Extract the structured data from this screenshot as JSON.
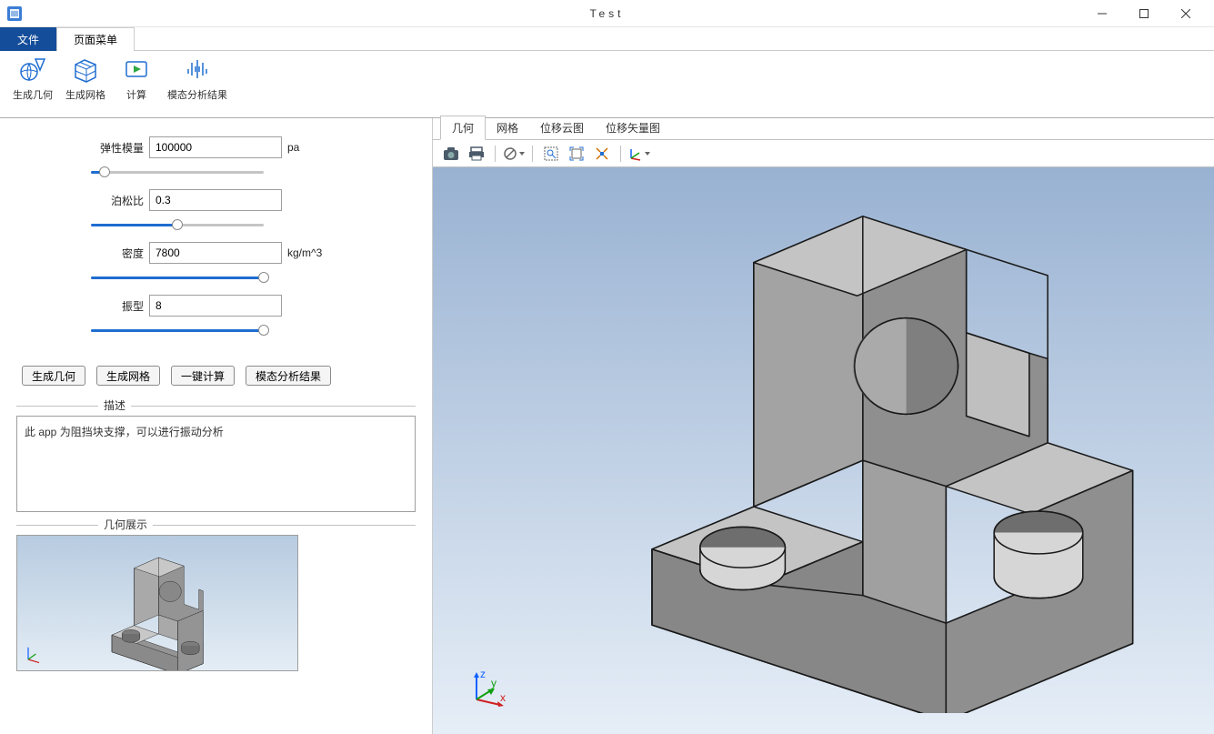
{
  "titlebar": {
    "title": "Test"
  },
  "ribbon": {
    "file_tab": "文件",
    "page_menu_tab": "页面菜单",
    "items": [
      {
        "label": "生成几何"
      },
      {
        "label": "生成网格"
      },
      {
        "label": "计算"
      },
      {
        "label": "模态分析结果"
      }
    ]
  },
  "form": {
    "elastic_modulus": {
      "label": "弹性模量",
      "value": "100000",
      "unit": "pa",
      "slider_pct": 8
    },
    "poisson_ratio": {
      "label": "泊松比",
      "value": "0.3",
      "unit": "",
      "slider_pct": 50
    },
    "density": {
      "label": "密度",
      "value": "7800",
      "unit": "kg/m^3",
      "slider_pct": 100
    },
    "mode_shape": {
      "label": "振型",
      "value": "8",
      "unit": "",
      "slider_pct": 100
    }
  },
  "buttons": {
    "gen_geom": "生成几何",
    "gen_mesh": "生成网格",
    "compute": "一键计算",
    "modal_result": "模态分析结果"
  },
  "fieldsets": {
    "description": {
      "legend": "描述",
      "text": "此 app 为阻挡块支撑，可以进行振动分析"
    },
    "geom_preview": {
      "legend": "几何展示"
    }
  },
  "viewer_tabs": {
    "geometry": "几何",
    "mesh": "网格",
    "disp_contour": "位移云图",
    "disp_vector": "位移矢量图"
  },
  "axis": {
    "x": "x",
    "y": "y",
    "z": "z"
  }
}
